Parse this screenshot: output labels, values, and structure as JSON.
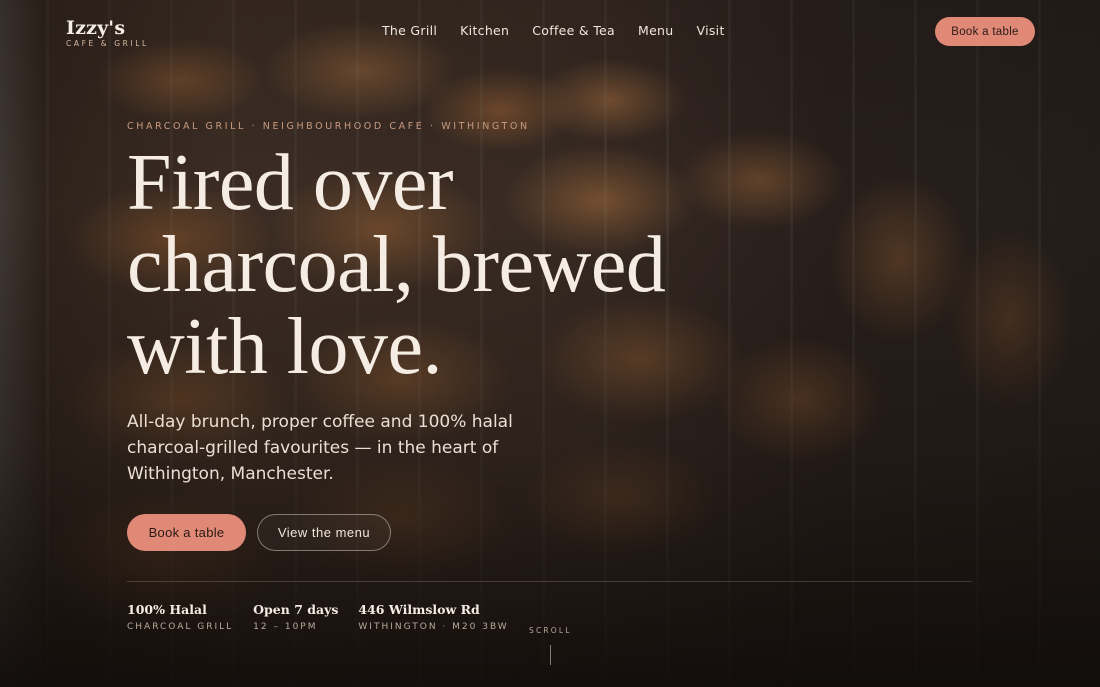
{
  "brand": {
    "name": "Izzy's",
    "tagline": "CAFE & GRILL"
  },
  "nav": {
    "items": [
      {
        "label": "The Grill"
      },
      {
        "label": "Kitchen"
      },
      {
        "label": "Coffee & Tea"
      },
      {
        "label": "Menu"
      },
      {
        "label": "Visit"
      }
    ],
    "cta_label": "Book a table"
  },
  "hero": {
    "eyebrow": "CHARCOAL GRILL · NEIGHBOURHOOD CAFE · WITHINGTON",
    "headline": [
      "Fired over",
      "charcoal, brewed",
      "with love."
    ],
    "lede": "All-day brunch, proper coffee and 100% halal charcoal-grilled favourites — in the heart of Withington, Manchester.",
    "primary_cta": "Book a table",
    "secondary_cta": "View the menu"
  },
  "facts": [
    {
      "title": "100% Halal",
      "subtitle": "CHARCOAL GRILL"
    },
    {
      "title": "Open 7 days",
      "subtitle": "12 – 10PM"
    },
    {
      "title": "446 Wilmslow Rd",
      "subtitle": "WITHINGTON · M20 3BW"
    }
  ],
  "scroll_label": "SCROLL",
  "colors": {
    "accent": "#e18977",
    "text_light": "#f5ede3",
    "eyebrow": "#c79a80",
    "background_dark": "#1a1411"
  }
}
